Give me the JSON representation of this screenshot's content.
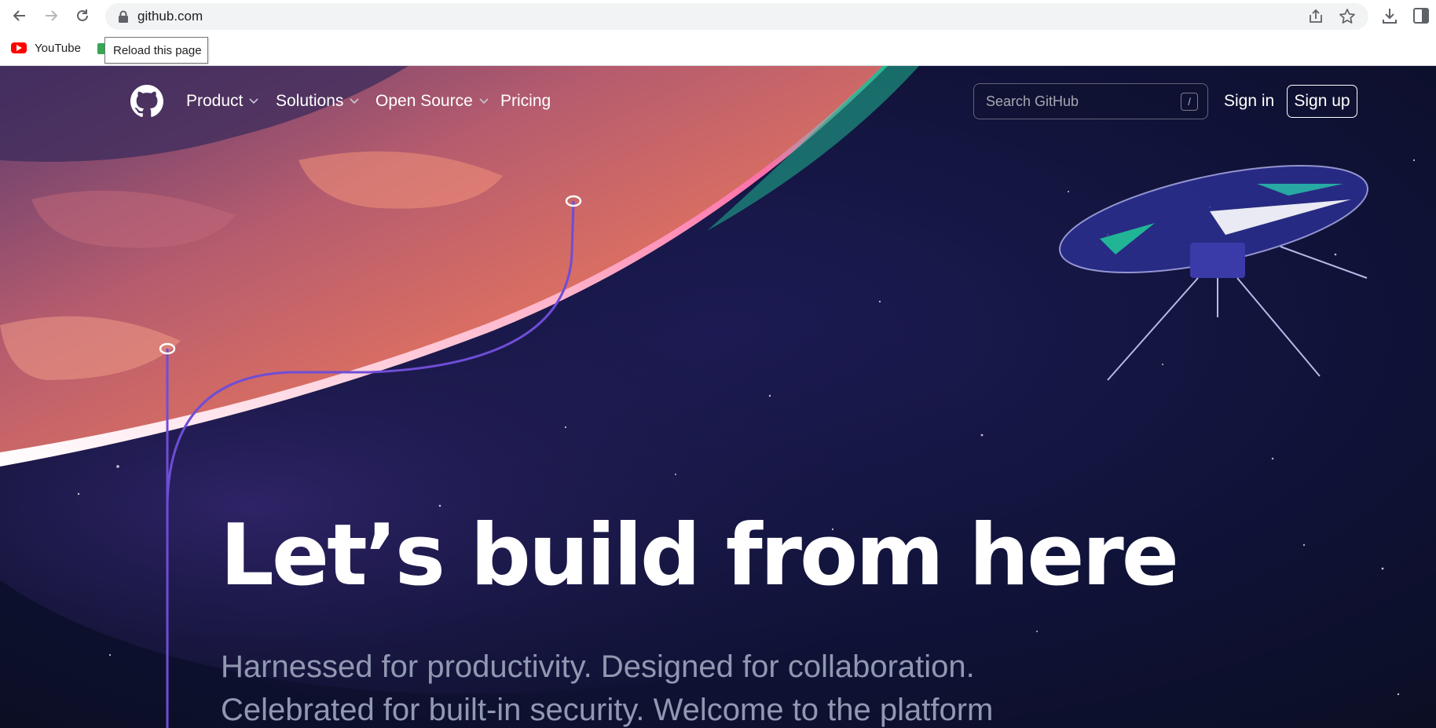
{
  "browser": {
    "url": "github.com",
    "nav": {
      "back_icon": "arrow-left-icon",
      "forward_icon": "arrow-right-icon",
      "reload_icon": "reload-icon"
    },
    "bookmarks": [
      {
        "label": "YouTube",
        "icon": "youtube-icon"
      }
    ],
    "tooltip": "Reload this page"
  },
  "header": {
    "logo_icon": "github-octocat-icon",
    "nav": [
      {
        "label": "Product",
        "dropdown": true
      },
      {
        "label": "Solutions",
        "dropdown": true
      },
      {
        "label": "Open Source",
        "dropdown": true
      },
      {
        "label": "Pricing",
        "dropdown": false
      }
    ],
    "search": {
      "placeholder": "Search GitHub",
      "shortcut": "/"
    },
    "sign_in": "Sign in",
    "sign_up": "Sign up"
  },
  "hero": {
    "title": "Let’s build from here",
    "subtitle_line1": "Harnessed for productivity. Designed for collaboration.",
    "subtitle_line2": "Celebrated for built-in security. Welcome to the platform"
  },
  "colors": {
    "page_background": "#0e1230",
    "planet": "#e8765e",
    "accent_line": "#6f4dd6",
    "subtitle": "#9198b1"
  }
}
